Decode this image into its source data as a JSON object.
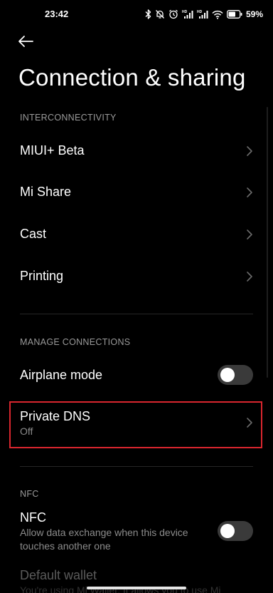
{
  "status_bar": {
    "time": "23:42",
    "battery_percent": "59%",
    "icons": [
      "bluetooth-icon",
      "alarm-off-icon",
      "alarm-icon",
      "hd-signal-icon",
      "hd-signal-icon",
      "wifi-icon",
      "battery-icon"
    ]
  },
  "header": {
    "back_icon": "back-arrow-icon",
    "title": "Connection & sharing"
  },
  "sections": {
    "interconnectivity": {
      "header": "INTERCONNECTIVITY",
      "items": [
        {
          "label": "MIUI+ Beta"
        },
        {
          "label": "Mi Share"
        },
        {
          "label": "Cast"
        },
        {
          "label": "Printing"
        }
      ]
    },
    "manage_connections": {
      "header": "MANAGE CONNECTIONS",
      "airplane_mode": {
        "label": "Airplane mode",
        "enabled": false
      },
      "private_dns": {
        "label": "Private DNS",
        "value": "Off"
      }
    },
    "nfc": {
      "header": "NFC",
      "nfc_item": {
        "label": "NFC",
        "description_line1": "Allow data exchange when this device",
        "description_line2": "touches another one",
        "enabled": false
      },
      "default_wallet": {
        "label": "Default wallet",
        "description": "You're using Mi Wallet. It allows you to use Mi"
      }
    }
  },
  "colors": {
    "background": "#000000",
    "text_primary": "#ffffff",
    "text_secondary": "#8c8c8c",
    "section_header": "#9a9a9a",
    "highlight": "#d9262e",
    "toggle_off": "#3a3a3a"
  }
}
